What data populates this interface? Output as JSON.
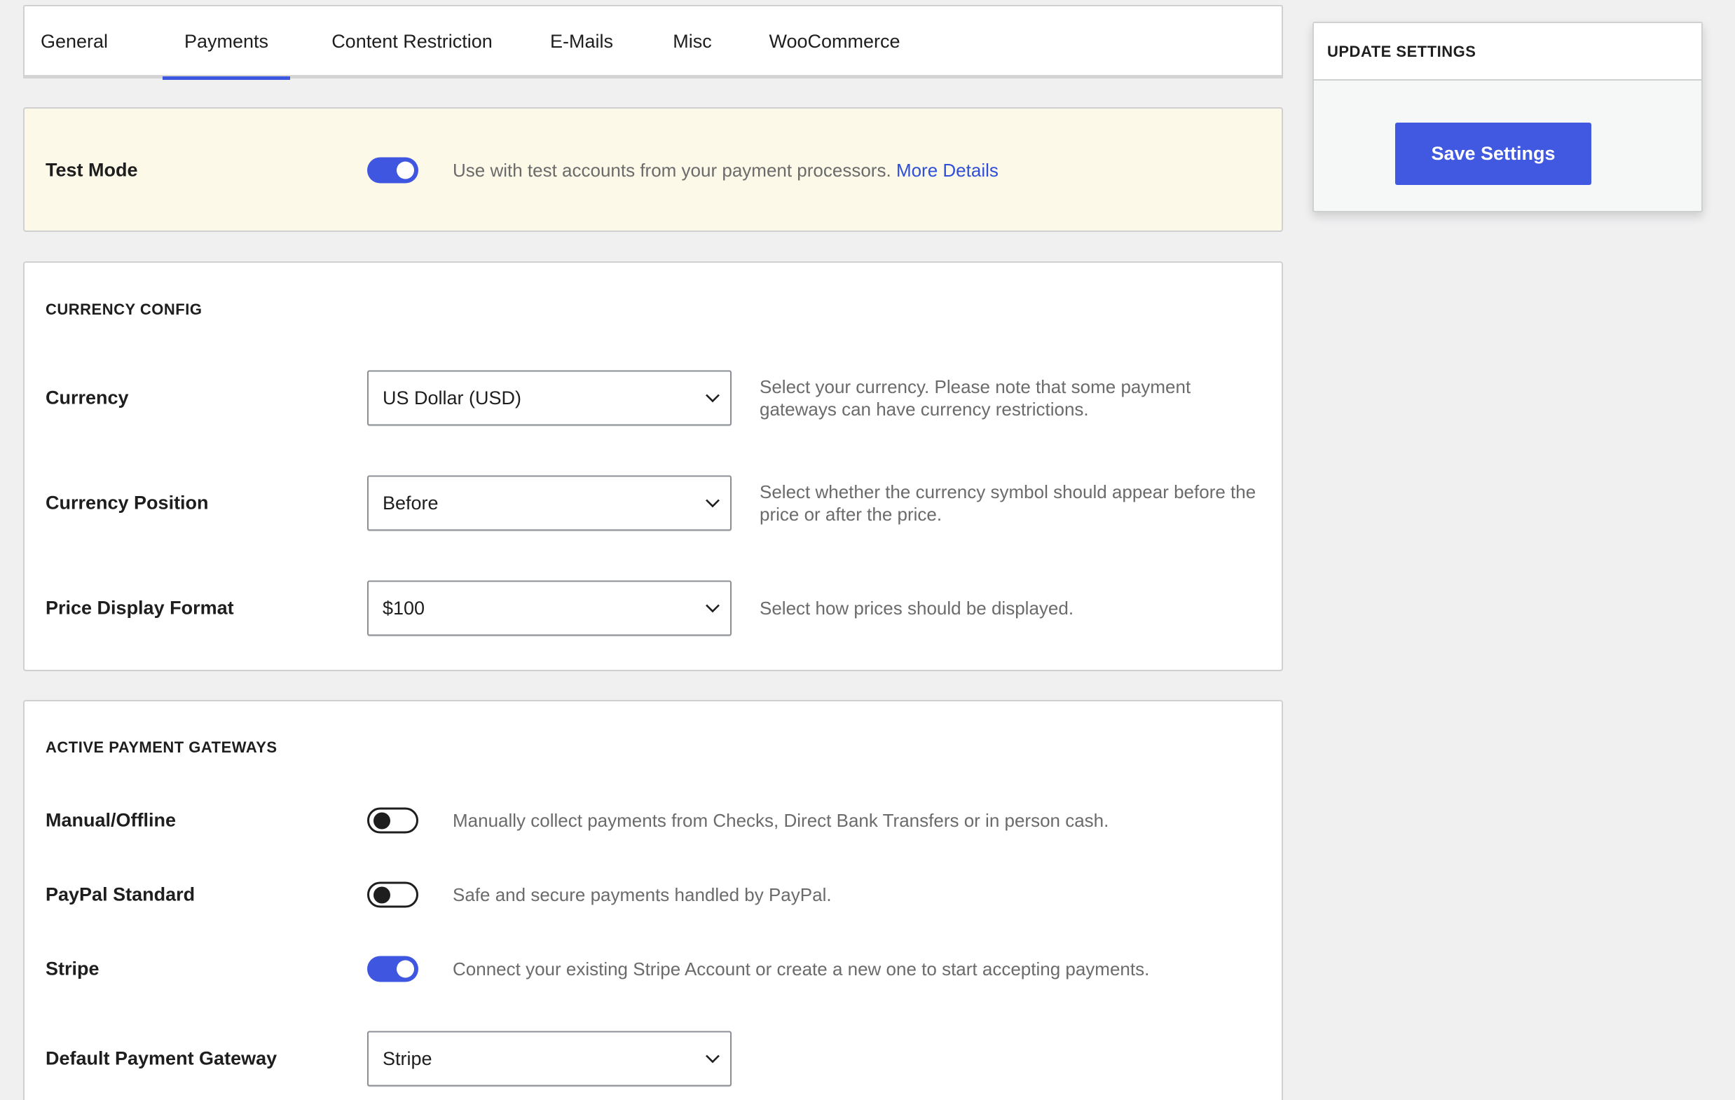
{
  "tabs": [
    {
      "label": "General",
      "active": false
    },
    {
      "label": "Payments",
      "active": true
    },
    {
      "label": "Content Restriction",
      "active": false
    },
    {
      "label": "E-Mails",
      "active": false
    },
    {
      "label": "Misc",
      "active": false
    },
    {
      "label": "WooCommerce",
      "active": false
    }
  ],
  "test_mode": {
    "label": "Test Mode",
    "enabled": true,
    "description": "Use with test accounts from your payment processors.",
    "link_label": "More Details"
  },
  "currency_config": {
    "title": "CURRENCY CONFIG",
    "fields": [
      {
        "label": "Currency",
        "value": "US Dollar (USD)",
        "description": "Select your currency. Please note that some payment gateways can have currency restrictions."
      },
      {
        "label": "Currency Position",
        "value": "Before",
        "description": "Select whether the currency symbol should appear before the price or after the price."
      },
      {
        "label": "Price Display Format",
        "value": "$100",
        "description": "Select how prices should be displayed."
      }
    ]
  },
  "payment_gateways": {
    "title": "ACTIVE PAYMENT GATEWAYS",
    "gateways": [
      {
        "label": "Manual/Offline",
        "enabled": false,
        "description": "Manually collect payments from Checks, Direct Bank Transfers or in person cash."
      },
      {
        "label": "PayPal Standard",
        "enabled": false,
        "description": "Safe and secure payments handled by PayPal."
      },
      {
        "label": "Stripe",
        "enabled": true,
        "description": "Connect your existing Stripe Account or create a new one to start accepting payments."
      }
    ],
    "default_gateway": {
      "label": "Default Payment Gateway",
      "value": "Stripe"
    }
  },
  "sidebar": {
    "title": "UPDATE SETTINGS",
    "save_label": "Save Settings"
  },
  "colors": {
    "accent": "#4158e0",
    "notice_bg": "#fcf9e8",
    "link": "#2f4fd8"
  }
}
